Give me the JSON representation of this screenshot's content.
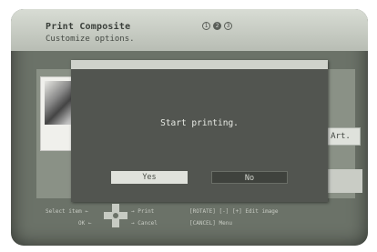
{
  "header": {
    "title": "Print Composite",
    "subtitle": "Customize options.",
    "steps": [
      "1",
      "2",
      "3"
    ]
  },
  "side_button": {
    "label": "Art."
  },
  "dialog": {
    "message": "Start printing.",
    "yes_label": "Yes",
    "no_label": "No"
  },
  "footer": {
    "select_item": "Select item",
    "ok": "OK",
    "print": "Print",
    "cancel": "Cancel",
    "rotate": "[ROTATE] [-] [+] Edit image",
    "cancel_menu": "[CANCEL] Menu"
  },
  "colors": {
    "screen_bg": "#6b7268",
    "header_bg": "#c8ccc4",
    "dialog_bg": "#525550",
    "yes_bg": "#e0e2dc",
    "no_bg": "#3f423d"
  },
  "icons": {
    "dpad": "dpad-icon"
  }
}
